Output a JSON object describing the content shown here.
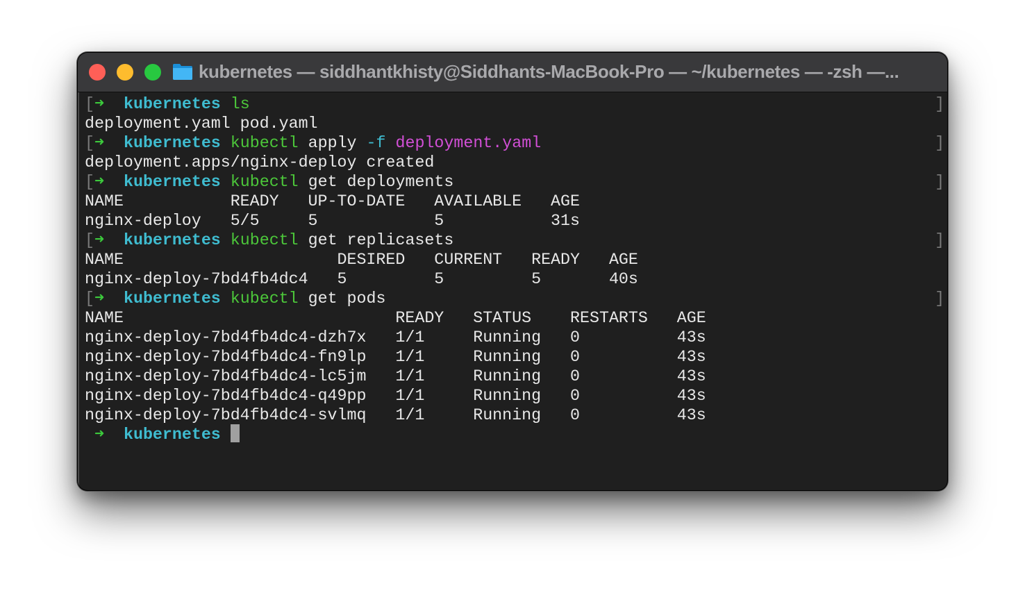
{
  "window": {
    "title": "kubernetes — siddhantkhisty@Siddhants-MacBook-Pro — ~/kubernetes — -zsh —...",
    "traffic_lights": {
      "close": "#fe5f57",
      "minimize": "#febc2e",
      "zoom": "#28c840"
    },
    "icon": "folder-icon"
  },
  "prompt": {
    "mark": "[",
    "arrow": "➜",
    "dir": "kubernetes",
    "right_mark": "]"
  },
  "terminal": {
    "commands": [
      {
        "cmd": "ls",
        "rest": "",
        "flag": "",
        "arg": ""
      },
      {
        "cmd": "kubectl",
        "rest": " apply ",
        "flag": "-f",
        "arg": " deployment.yaml"
      },
      {
        "cmd": "kubectl",
        "rest": " get deployments",
        "flag": "",
        "arg": ""
      },
      {
        "cmd": "kubectl",
        "rest": " get replicasets",
        "flag": "",
        "arg": ""
      },
      {
        "cmd": "kubectl",
        "rest": " get pods",
        "flag": "",
        "arg": ""
      }
    ],
    "ls_output": "deployment.yaml pod.yaml",
    "apply_output": "deployment.apps/nginx-deploy created",
    "deployments": {
      "header": "NAME           READY   UP-TO-DATE   AVAILABLE   AGE",
      "rows": [
        "nginx-deploy   5/5     5            5           31s"
      ]
    },
    "replicasets": {
      "header": "NAME                      DESIRED   CURRENT   READY   AGE",
      "rows": [
        "nginx-deploy-7bd4fb4dc4   5         5         5       40s"
      ]
    },
    "pods": {
      "header": "NAME                            READY   STATUS    RESTARTS   AGE",
      "rows": [
        "nginx-deploy-7bd4fb4dc4-dzh7x   1/1     Running   0          43s",
        "nginx-deploy-7bd4fb4dc4-fn9lp   1/1     Running   0          43s",
        "nginx-deploy-7bd4fb4dc4-lc5jm   1/1     Running   0          43s",
        "nginx-deploy-7bd4fb4dc4-q49pp   1/1     Running   0          43s",
        "nginx-deploy-7bd4fb4dc4-svlmq   1/1     Running   0          43s"
      ]
    }
  }
}
